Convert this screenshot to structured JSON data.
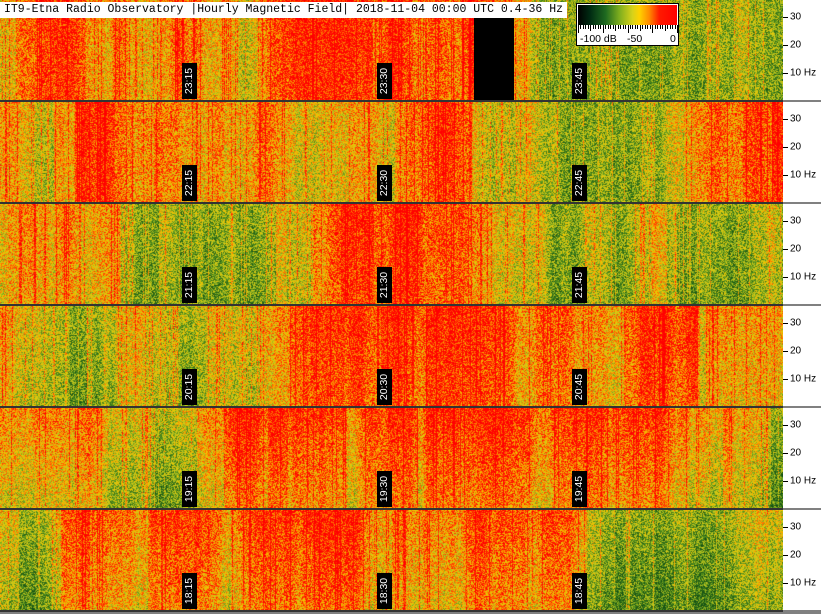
{
  "title": "IT9-Etna Radio Observatory |Hourly Magnetic Field| 2018-11-04 00:00 UTC 0.4-36 Hz",
  "legend": {
    "ticks": [
      "-100 dB",
      "-50",
      "0"
    ],
    "scale_db": [
      -100,
      0
    ]
  },
  "chart_data": {
    "type": "heatmap",
    "title": "IT9-Etna Radio Observatory |Hourly Magnetic Field| 2018-11-04 00:00 UTC 0.4-36 Hz",
    "frequency_range_hz": [
      0.4,
      36
    ],
    "frequency_ticks": [
      "30",
      "20",
      "10 Hz"
    ],
    "color_scale_db": [
      -100,
      0
    ],
    "colors": [
      "#000000",
      "#1f6a20",
      "#7fae1e",
      "#d7d21a",
      "#ff8a00",
      "#ff0000"
    ],
    "rows": [
      {
        "hour": "23",
        "time_labels": [
          "23:15",
          "23:30",
          "23:45"
        ],
        "data_gap": true
      },
      {
        "hour": "22",
        "time_labels": [
          "22:15",
          "22:30",
          "22:45"
        ]
      },
      {
        "hour": "21",
        "time_labels": [
          "21:15",
          "21:30",
          "21:45"
        ]
      },
      {
        "hour": "20",
        "time_labels": [
          "20:15",
          "20:30",
          "20:45"
        ]
      },
      {
        "hour": "19",
        "time_labels": [
          "19:15",
          "19:30",
          "19:45"
        ]
      },
      {
        "hour": "18",
        "time_labels": [
          "18:15",
          "18:30",
          "18:45"
        ]
      }
    ]
  }
}
